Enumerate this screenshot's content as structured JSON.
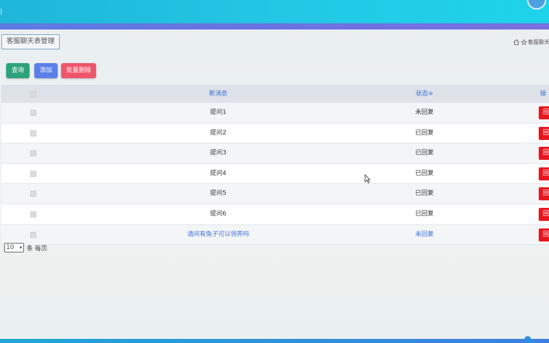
{
  "header": {
    "title_button": "客服聊天表管理",
    "breadcrumb_text": "客服聊天"
  },
  "toolbar": {
    "query_label": "查询",
    "add_label": "添加",
    "batch_delete_label": "批量删除"
  },
  "table": {
    "columns": {
      "message": "新消息",
      "status": "状态≑",
      "operation": "操"
    },
    "rows": [
      {
        "message": "提问1",
        "status": "未回复",
        "action": "回"
      },
      {
        "message": "提问2",
        "status": "已回复",
        "action": "回"
      },
      {
        "message": "提问3",
        "status": "已回复",
        "action": "回"
      },
      {
        "message": "提问4",
        "status": "已回复",
        "action": "回"
      },
      {
        "message": "提问5",
        "status": "已回复",
        "action": "回"
      },
      {
        "message": "提问6",
        "status": "已回复",
        "action": "回"
      },
      {
        "message": "请问有兔子可以领养吗",
        "status": "未回复",
        "action": "回"
      }
    ]
  },
  "pager": {
    "page_size": "10",
    "per_page_label": "条 每页"
  },
  "colors": {
    "topbar": "#22c7e4",
    "accent_blue": "#3b6fd8",
    "danger": "#e8171f",
    "success": "#2ea37b"
  },
  "icons": [
    "menu-icon",
    "home-icon",
    "star-icon",
    "sort-icon",
    "caret-down-icon",
    "cursor-icon"
  ]
}
